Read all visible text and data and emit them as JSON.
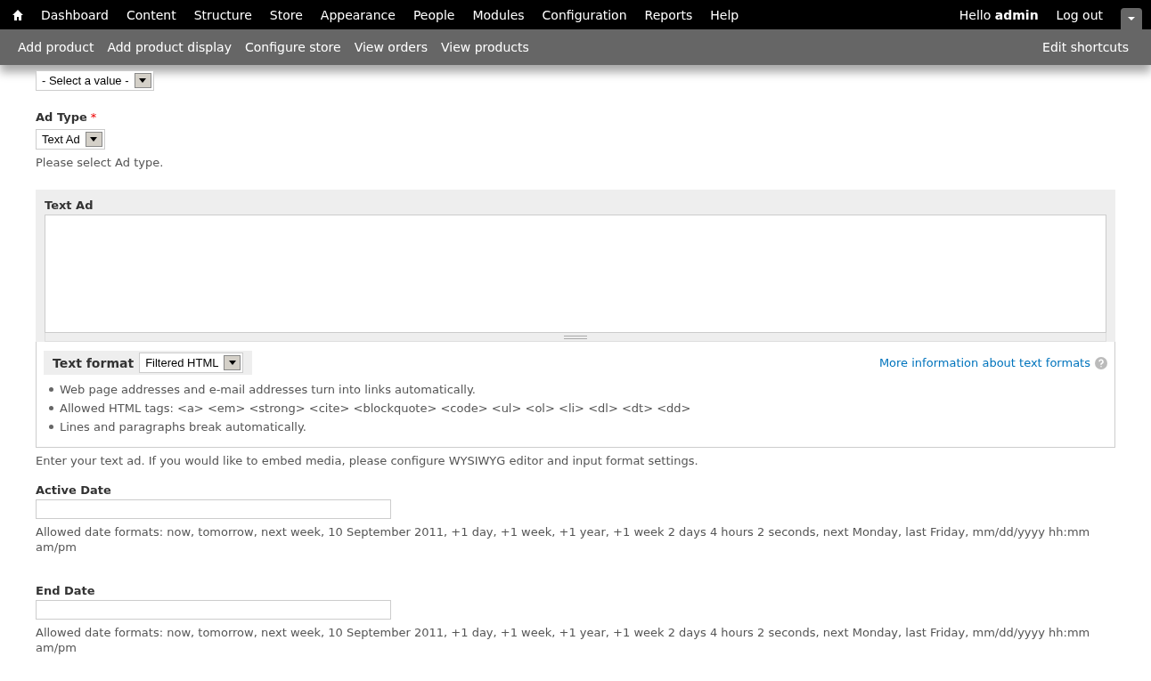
{
  "toolbar": {
    "menu": [
      "Dashboard",
      "Content",
      "Structure",
      "Store",
      "Appearance",
      "People",
      "Modules",
      "Configuration",
      "Reports",
      "Help"
    ],
    "greeting": "Hello **admin**",
    "logout": "Log out",
    "shortcuts_expanded": true
  },
  "shortcuts": {
    "items": [
      "Add product",
      "Add product display",
      "Configure store",
      "View orders",
      "View products"
    ],
    "edit": "Edit shortcuts"
  },
  "form": {
    "previous_select": {
      "value": "- Select a value -"
    },
    "ad_type": {
      "label": "Ad Type",
      "required_mark": "*",
      "value": "Text Ad",
      "description": "Please select Ad type."
    },
    "text_ad": {
      "label": "Text Ad",
      "format_label": "Text format",
      "format_value": "Filtered HTML",
      "more_info": "More information about text formats",
      "tips": [
        "Web page addresses and e-mail addresses turn into links automatically.",
        "Allowed HTML tags: <a> <em> <strong> <cite> <blockquote> <code> <ul> <ol> <li> <dl> <dt> <dd>",
        "Lines and paragraphs break automatically."
      ],
      "description": "Enter your text ad. If you would like to embed media, please configure WYSIWYG editor and input format settings."
    },
    "dates": [
      {
        "label": "Active Date",
        "description": "Allowed date formats: now, tomorrow, next week, 10 September 2011, +1 day, +1 week, +1 year, +1 week 2 days 4 hours 2 seconds, next Monday, last Friday, mm/dd/yyyy hh:mm am/pm"
      },
      {
        "label": "End Date",
        "description": "Allowed date formats: now, tomorrow, next week, 10 September 2011, +1 day, +1 week, +1 year, +1 week 2 days 4 hours 2 seconds, next Monday, last Friday, mm/dd/yyyy hh:mm am/pm"
      }
    ]
  }
}
